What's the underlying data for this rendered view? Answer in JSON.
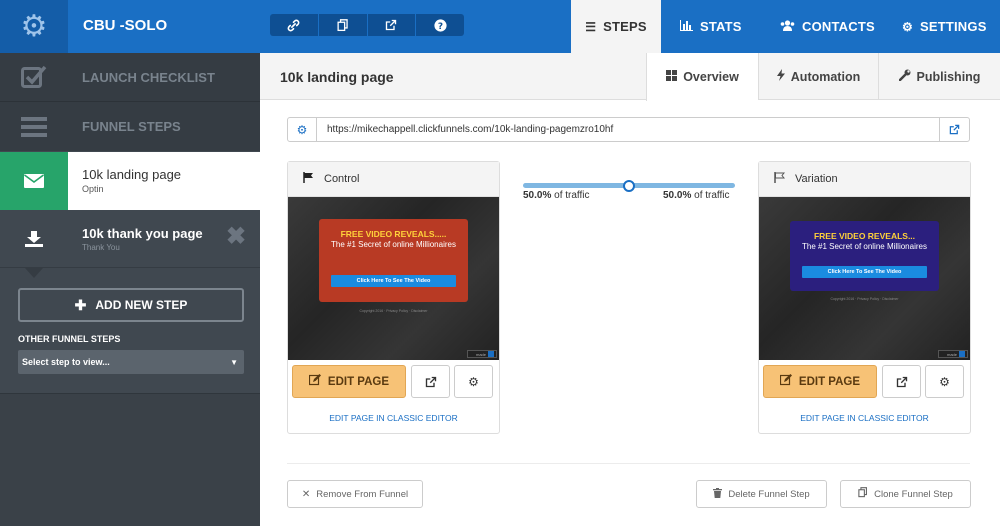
{
  "header": {
    "funnel_name": "CBU -SOLO",
    "tools": [
      "link-icon",
      "copy-icon",
      "external-link-icon",
      "help-icon"
    ],
    "nav": [
      {
        "label": "STEPS",
        "icon": "list-icon",
        "active": true
      },
      {
        "label": "STATS",
        "icon": "bar-chart-icon"
      },
      {
        "label": "CONTACTS",
        "icon": "users-icon"
      },
      {
        "label": "SETTINGS",
        "icon": "gear-icon"
      }
    ]
  },
  "sidebar": {
    "launch_checklist": "LAUNCH CHECKLIST",
    "funnel_steps": "FUNNEL STEPS",
    "steps": [
      {
        "title": "10k landing page",
        "subtitle": "Optin",
        "icon": "envelope-icon",
        "active": true
      },
      {
        "title": "10k thank you page",
        "subtitle": "Thank You",
        "icon": "download-icon"
      }
    ],
    "add_step": "ADD NEW STEP",
    "other_label": "OTHER FUNNEL STEPS",
    "select_placeholder": "Select step to view..."
  },
  "content": {
    "page_title": "10k landing page",
    "tabs": [
      {
        "label": "Overview",
        "icon": "grid-icon",
        "active": true
      },
      {
        "label": "Automation",
        "icon": "bolt-icon"
      },
      {
        "label": "Publishing",
        "icon": "wrench-icon"
      }
    ],
    "url": "https://mikechappell.clickfunnels.com/10k-landing-pagemzro10hf",
    "control": {
      "label": "Control",
      "edit": "EDIT PAGE",
      "classic": "EDIT PAGE IN CLASSIC EDITOR",
      "promo_h1": "FREE VIDEO REVEALS.....",
      "promo_h2": "The #1 Secret of online Millionaires",
      "promo_btn": "Click Here To See The Video"
    },
    "variation": {
      "label": "Variation",
      "edit": "EDIT PAGE",
      "classic": "EDIT PAGE IN CLASSIC EDITOR",
      "promo_h1": "FREE VIDEO REVEALS...",
      "promo_h2": "The #1 Secret of online Millionaires",
      "promo_btn": "Click Here To See The Video"
    },
    "traffic": {
      "control_pct": "50.0%",
      "variation_pct": "50.0%",
      "suffix": "of traffic",
      "split": 0.5
    },
    "footer": {
      "remove": "Remove From Funnel",
      "delete": "Delete Funnel Step",
      "clone": "Clone Funnel Step"
    }
  },
  "colors": {
    "brand_blue": "#1a6fc4",
    "step_green": "#27a46a",
    "edit_orange": "#f7c276",
    "sidebar_dark": "#404850"
  }
}
